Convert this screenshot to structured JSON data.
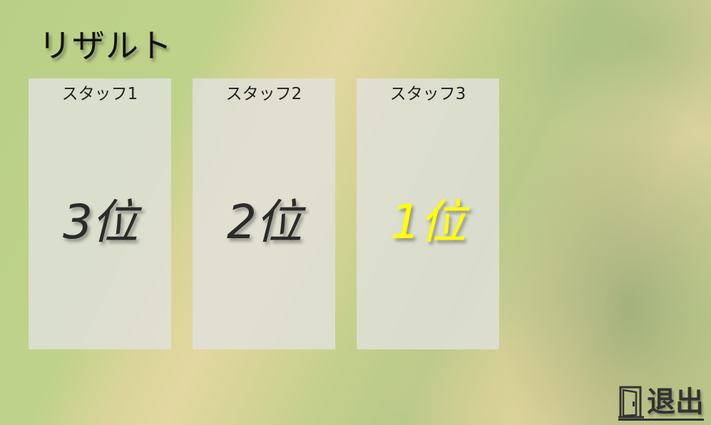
{
  "title": "リザルト",
  "cards": [
    {
      "name": "スタッフ1",
      "rank": "3位",
      "highlight": false
    },
    {
      "name": "スタッフ2",
      "rank": "2位",
      "highlight": false
    },
    {
      "name": "スタッフ3",
      "rank": "1位",
      "highlight": true
    }
  ],
  "exit": {
    "label": "退出",
    "icon": "door-icon"
  },
  "colors": {
    "winner_rank": "#ffff00",
    "rank": "#2b2b2b"
  }
}
